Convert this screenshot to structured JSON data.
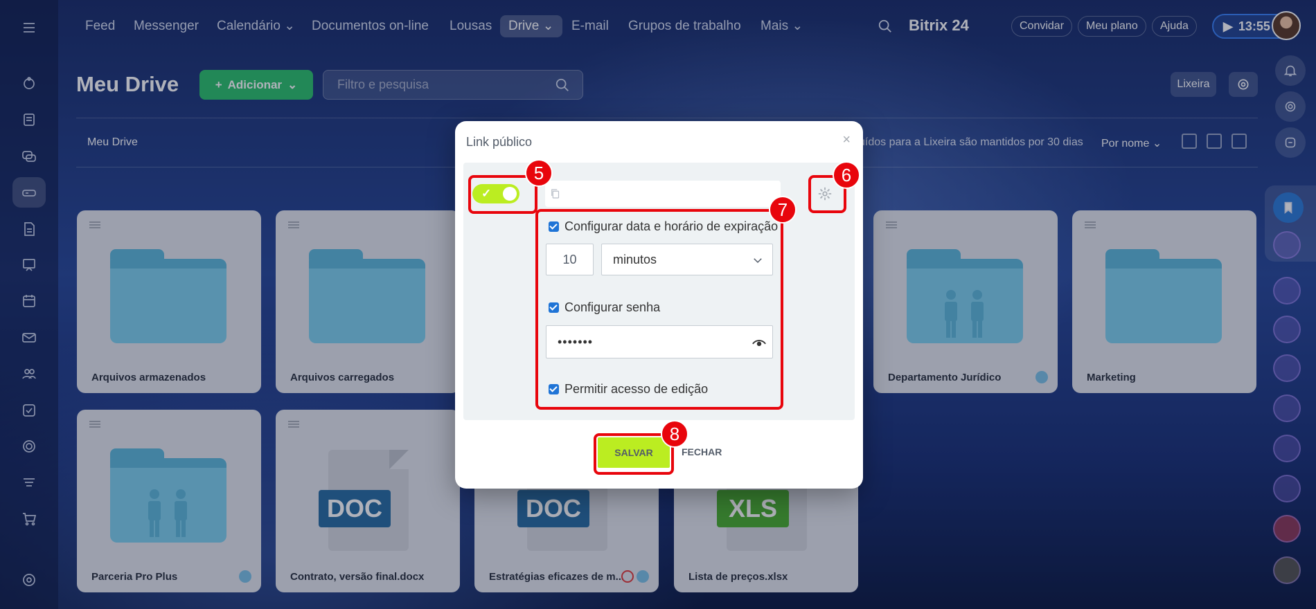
{
  "topnav": {
    "items": [
      "Feed",
      "Messenger",
      "Calendário",
      "Documentos on-line",
      "Lousas",
      "Drive",
      "E-mail",
      "Grupos de trabalho",
      "Mais"
    ],
    "brand": "Bitrix 24",
    "invite": "Convidar",
    "plan": "Meu plano",
    "help": "Ajuda",
    "time": "13:55"
  },
  "header": {
    "title": "Meu Drive",
    "add_label": "Adicionar",
    "filter_placeholder": "Filtro e pesquisa",
    "trash_label": "Lixeira"
  },
  "breadcrumb": {
    "root": "Meu Drive",
    "info": "uídos para a Lixeira são mantidos por 30 dias",
    "sort": "Por nome"
  },
  "tiles": [
    {
      "name": "Arquivos armazenados",
      "type": "folder"
    },
    {
      "name": "Arquivos carregados",
      "type": "folder"
    },
    {
      "name": "Departamento Jurídico",
      "type": "shared-folder"
    },
    {
      "name": "Marketing",
      "type": "folder"
    },
    {
      "name": "Parceria Pro Plus",
      "type": "shared-folder"
    },
    {
      "name": "Contrato, versão final.docx",
      "type": "doc",
      "badge": "DOC"
    },
    {
      "name": "Estratégias eficazes de m...",
      "type": "doc",
      "badge": "DOC"
    },
    {
      "name": "Lista de preços.xlsx",
      "type": "xls",
      "badge": "XLS"
    }
  ],
  "modal": {
    "title": "Link público",
    "close": "×",
    "expiry_label": "Configurar data e horário de expiração",
    "expiry_value": "10",
    "expiry_unit": "minutos",
    "password_label": "Configurar senha",
    "password_value": "•••••••",
    "edit_label": "Permitir acesso de edição",
    "save": "SALVAR",
    "close_btn": "FECHAR"
  },
  "markers": [
    "5",
    "6",
    "7",
    "8"
  ],
  "colors": {
    "accent_green": "#bbed21",
    "highlight_red": "#e8050c",
    "add_button": "#2fc26e",
    "folder_blue": "#7fd0ee",
    "doc_badge": "#2a6ea3",
    "xls_badge": "#4caf32"
  }
}
